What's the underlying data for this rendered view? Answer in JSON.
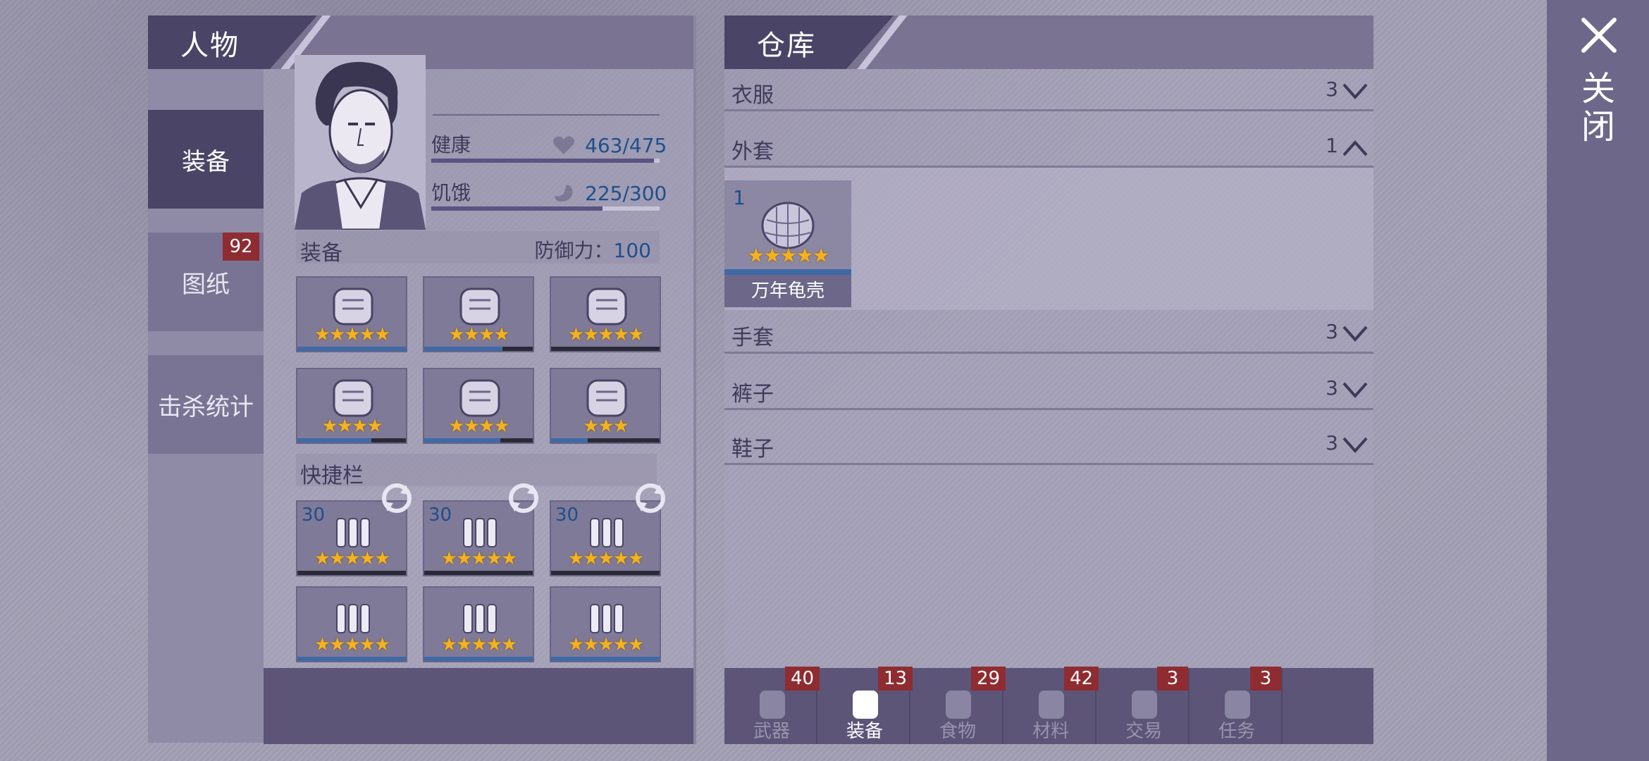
{
  "close_label": "关闭",
  "character": {
    "title": "人物",
    "side_tabs": [
      {
        "label": "装备",
        "active": true
      },
      {
        "label": "图纸",
        "badge": "92"
      },
      {
        "label": "击杀统计"
      }
    ],
    "stats": {
      "health_label": "健康",
      "health_value": "463/475",
      "health_fraction": 0.975,
      "hunger_label": "饥饿",
      "hunger_value": "225/300",
      "hunger_fraction": 0.75
    },
    "equipment_header": "装备",
    "defense_label": "防御力：",
    "defense_value": "100",
    "equipment_slots": [
      {
        "icon": "bird-mask-icon",
        "stars": "★★★★★",
        "durability": 1.0
      },
      {
        "icon": "body-armor-icon",
        "stars": "★★★★",
        "durability": 0.72
      },
      {
        "icon": "turtle-shell-icon",
        "stars": "★★★★★",
        "durability": 0.0
      },
      {
        "icon": "gloves-icon",
        "stars": "★★★★",
        "durability": 0.68
      },
      {
        "icon": "pants-icon",
        "stars": "★★★★",
        "durability": 0.7
      },
      {
        "icon": "shoes-icon",
        "stars": "★★★",
        "durability": 0.34
      }
    ],
    "quickbar_header": "快捷栏",
    "quick_slots": [
      {
        "icon": "bullets-icon",
        "count": "30",
        "stars": "★★★★★",
        "durability": 0
      },
      {
        "icon": "shells-icon",
        "count": "30",
        "stars": "★★★★★",
        "durability": 0
      },
      {
        "icon": "rifle-ammo-icon",
        "count": "30",
        "stars": "★★★★★",
        "durability": 0
      },
      {
        "icon": "revolver-icon",
        "count": "",
        "stars": "★★★★★",
        "durability": 1.0
      },
      {
        "icon": "shotgun-icon",
        "count": "",
        "stars": "★★★★★",
        "durability": 1.0
      },
      {
        "icon": "rifle-icon",
        "count": "",
        "stars": "★★★★★",
        "durability": 1.0
      }
    ]
  },
  "warehouse": {
    "title": "仓库",
    "categories": [
      {
        "label": "衣服",
        "count": "3",
        "expanded": false
      },
      {
        "label": "外套",
        "count": "1",
        "expanded": true
      },
      {
        "label": "手套",
        "count": "3",
        "expanded": false
      },
      {
        "label": "裤子",
        "count": "3",
        "expanded": false
      },
      {
        "label": "鞋子",
        "count": "3",
        "expanded": false
      }
    ],
    "items": [
      {
        "count": "1",
        "name": "万年龟壳",
        "stars": "★★★★★"
      }
    ],
    "tabs": [
      {
        "label": "武器",
        "badge": "40",
        "icon": "axe-icon"
      },
      {
        "label": "装备",
        "badge": "13",
        "icon": "shirt-icon",
        "active": true
      },
      {
        "label": "食物",
        "badge": "29",
        "icon": "meat-icon"
      },
      {
        "label": "材料",
        "badge": "42",
        "icon": "wood-icon"
      },
      {
        "label": "交易",
        "badge": "3",
        "icon": "coin-icon"
      },
      {
        "label": "任务",
        "badge": "3",
        "icon": "key-icon"
      }
    ]
  }
}
